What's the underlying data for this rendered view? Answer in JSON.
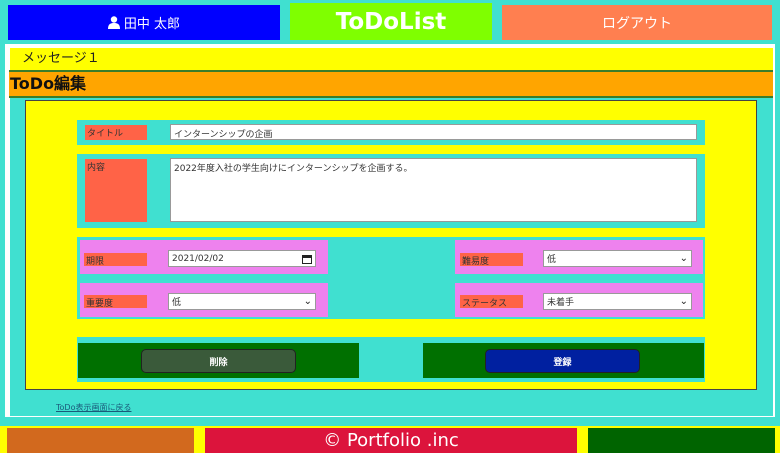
{
  "header": {
    "user_name": "田中 太郎",
    "app_title": "ToDoList",
    "logout_label": "ログアウト"
  },
  "message": "メッセージ１",
  "page_heading": "ToDo編集",
  "form": {
    "title_label": "タイトル",
    "title_value": "インターンシップの企画",
    "content_label": "内容",
    "content_value": "2022年度入社の学生向けにインターンシップを企画する。",
    "due_label": "期限",
    "due_value": "2021/02/02",
    "difficulty_label": "難易度",
    "difficulty_value": "低",
    "importance_label": "重要度",
    "importance_value": "低",
    "status_label": "ステータス",
    "status_value": "未着手",
    "delete_label": "削除",
    "register_label": "登録"
  },
  "back_link": "ToDo表示画面に戻る",
  "footer_text": "© Portfolio .inc",
  "icons": {
    "user": "user-icon",
    "calendar": "calendar-icon",
    "dropdown": "chevron-down-icon"
  }
}
